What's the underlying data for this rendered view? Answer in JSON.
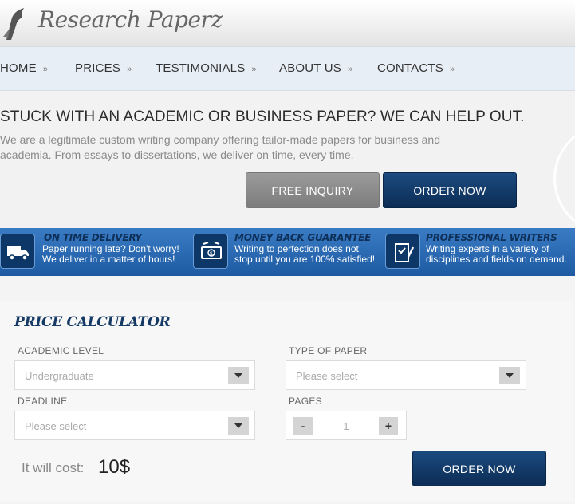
{
  "brand": {
    "name": "Research Paperz",
    "icon": "quill-logo-icon"
  },
  "nav": [
    {
      "label": "HOME",
      "arrow": "»"
    },
    {
      "label": "PRICES",
      "arrow": "»"
    },
    {
      "label": "TESTIMONIALS",
      "arrow": "»"
    },
    {
      "label": "ABOUT US",
      "arrow": "»"
    },
    {
      "label": "CONTACTS",
      "arrow": "»"
    }
  ],
  "hero": {
    "title": "STUCK WITH AN ACADEMIC OR BUSINESS PAPER? WE CAN HELP OUT.",
    "description": "We are a legitimate custom writing company offering tailor-made papers for business and academia. From essays to dissertations, we deliver on time, every time.",
    "free_inquiry": "FREE INQUIRY",
    "order_now": "ORDER NOW"
  },
  "benefits": [
    {
      "icon": "delivery-truck-icon",
      "title": "ON TIME DELIVERY",
      "text": "Paper running late? Don't worry! We deliver in a matter of hours!"
    },
    {
      "icon": "money-back-icon",
      "title": "MONEY BACK GUARANTEE",
      "text": "Writing to perfection does not stop until you are 100% satisfied!"
    },
    {
      "icon": "document-pen-icon",
      "title": "PROFESSIONAL WRITERS",
      "text": "Writing experts in a variety of disciplines and fields on demand."
    }
  ],
  "calculator": {
    "title": "PRICE CALCULATOR",
    "academic_level": {
      "label": "ACADEMIC LEVEL",
      "value": "Undergraduate"
    },
    "type_of_paper": {
      "label": "TYPE OF PAPER",
      "value": "Please select"
    },
    "deadline": {
      "label": "DEADLINE",
      "value": "Please select"
    },
    "pages": {
      "label": "PAGES",
      "minus": "-",
      "value": "1",
      "plus": "+"
    },
    "cost_label": "It will cost:",
    "cost_value": "10$",
    "order_now": "ORDER NOW"
  },
  "colors": {
    "accent": "#0c2d55",
    "benefit_band": "#2a6ab4",
    "nav_bg": "#e8eef6"
  }
}
